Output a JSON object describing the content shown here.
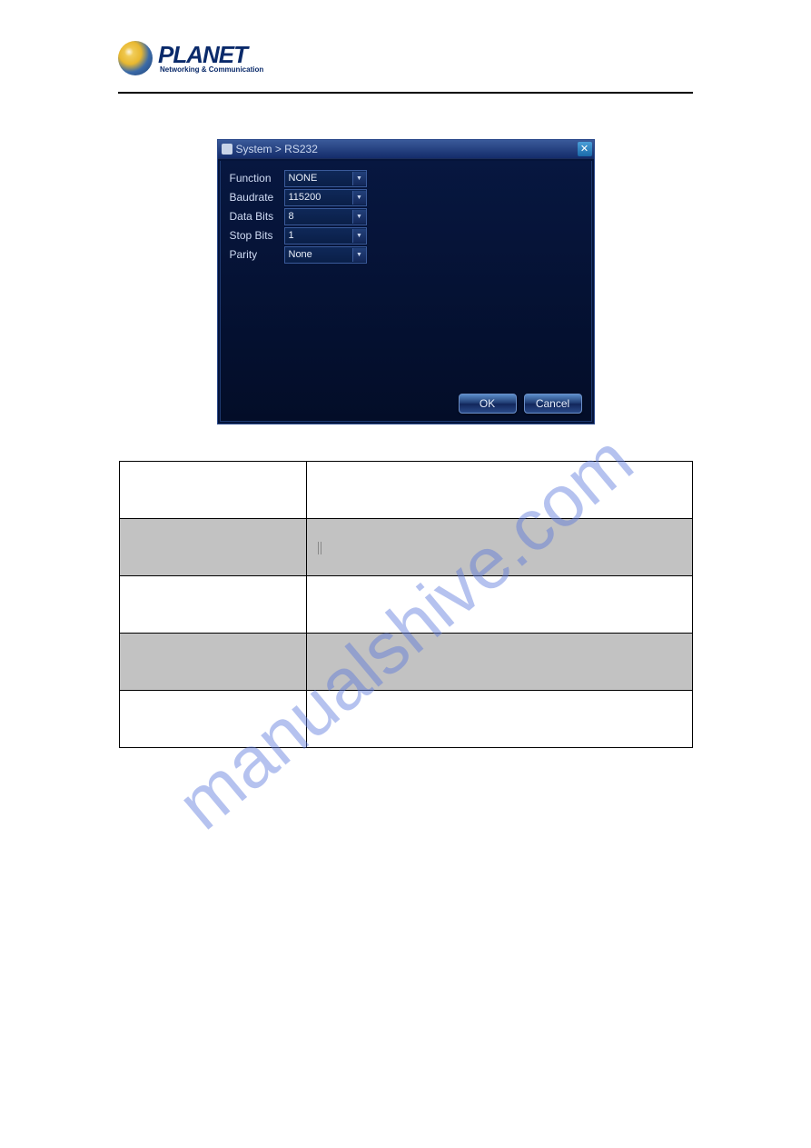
{
  "header": {
    "logo_main": "PLANET",
    "logo_sub": "Networking & Communication"
  },
  "dialog": {
    "title": "System > RS232",
    "close_glyph": "✕",
    "ok_label": "OK",
    "cancel_label": "Cancel",
    "fields": [
      {
        "label": "Function",
        "value": "NONE"
      },
      {
        "label": "Baudrate",
        "value": "115200"
      },
      {
        "label": "Data Bits",
        "value": "8"
      },
      {
        "label": "Stop Bits",
        "value": "1"
      },
      {
        "label": "Parity",
        "value": "None"
      }
    ]
  },
  "table": {
    "rows": [
      {
        "c1": "",
        "c2": "",
        "shade": false
      },
      {
        "c1": "",
        "c2": "",
        "shade": true
      },
      {
        "c1": "",
        "c2": "",
        "shade": false
      },
      {
        "c1": "",
        "c2": "",
        "shade": true
      },
      {
        "c1": "",
        "c2": "",
        "shade": false
      }
    ]
  },
  "watermark_text": "manualshive.com"
}
